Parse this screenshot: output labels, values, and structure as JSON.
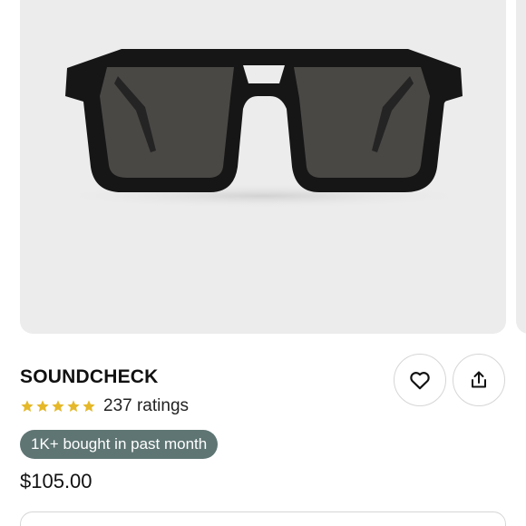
{
  "product": {
    "name": "SOUNDCHECK",
    "rating_stars": 5,
    "ratings_count": "237 ratings",
    "badge": "1K+ bought in past month",
    "price": "$105.00"
  },
  "icons": {
    "favorite": "heart-icon",
    "share": "share-icon",
    "star": "star-icon"
  },
  "colors": {
    "image_background": "#ececec",
    "star": "#e5b82a",
    "badge_background": "#5e7573",
    "badge_text": "#ffffff"
  }
}
